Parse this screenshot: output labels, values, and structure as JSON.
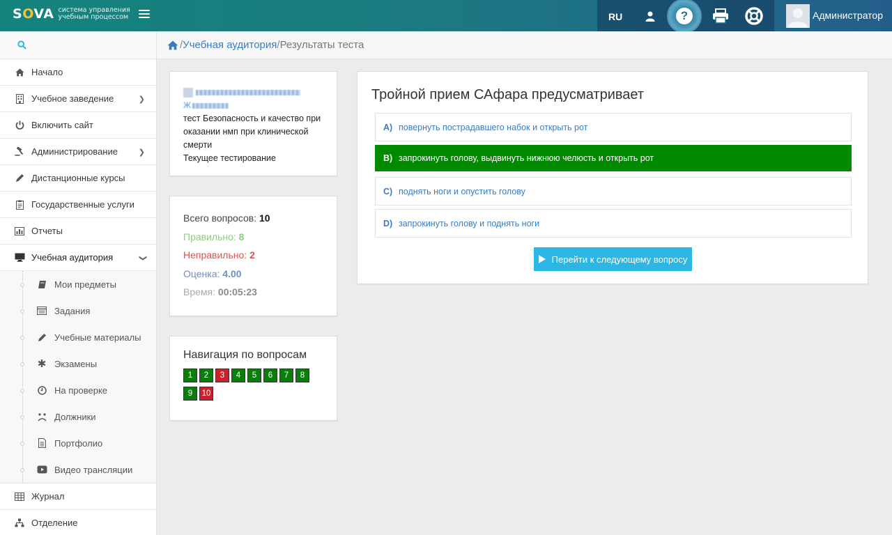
{
  "header": {
    "logo_text": "SOVA",
    "logo_sub_line1": "система управления",
    "logo_sub_line2": "учебным процессом",
    "lang": "RU",
    "user_name": "Администратор",
    "icons": [
      "user-icon",
      "help-icon",
      "print-icon",
      "lifebuoy-icon"
    ]
  },
  "sidebar": {
    "items": [
      {
        "label": "Начало",
        "icon": "home-icon"
      },
      {
        "label": "Учебное заведение",
        "icon": "building-icon",
        "has_children": true
      },
      {
        "label": "Включить сайт",
        "icon": "power-icon"
      },
      {
        "label": "Администрирование",
        "icon": "gavel-icon",
        "has_children": true
      },
      {
        "label": "Дистанционные курсы",
        "icon": "pencil-icon"
      },
      {
        "label": "Государственные услуги",
        "icon": "clipboard-icon"
      },
      {
        "label": "Отчеты",
        "icon": "bar-chart-icon"
      },
      {
        "label": "Учебная аудитория",
        "icon": "desktop-icon",
        "expanded": true
      }
    ],
    "subitems": [
      {
        "label": "Мои предметы",
        "icon": "book-icon"
      },
      {
        "label": "Задания",
        "icon": "list-icon"
      },
      {
        "label": "Учебные материалы",
        "icon": "pencil-icon"
      },
      {
        "label": "Экзамены",
        "icon": "asterisk-icon"
      },
      {
        "label": "На проверке",
        "icon": "clock-icon"
      },
      {
        "label": "Должники",
        "icon": "sad-face-icon"
      },
      {
        "label": "Портфолио",
        "icon": "document-icon"
      },
      {
        "label": "Видео трансляции",
        "icon": "video-icon"
      }
    ],
    "items_after": [
      {
        "label": "Журнал",
        "icon": "table-icon"
      },
      {
        "label": "Отделение",
        "icon": "sitemap-icon"
      }
    ]
  },
  "breadcrumb": {
    "sep": "/",
    "link": "Учебная аудитория",
    "current": "Результаты теста"
  },
  "info": {
    "test_line": "тест Безопасность и качество при оказании нмп при клинической смерти",
    "status": "Текущее тестирование"
  },
  "stats": {
    "total_label": "Всего вопросов:",
    "total_value": "10",
    "correct_label": "Правильно:",
    "correct_value": "8",
    "wrong_label": "Неправильно:",
    "wrong_value": "2",
    "score_label": "Оценка:",
    "score_value": "4.00",
    "time_label": "Время:",
    "time_value": "00:05:23"
  },
  "navigation": {
    "title": "Навигация по вопросам",
    "questions": [
      {
        "n": "1",
        "status": "correct"
      },
      {
        "n": "2",
        "status": "correct"
      },
      {
        "n": "3",
        "status": "wrong"
      },
      {
        "n": "4",
        "status": "correct"
      },
      {
        "n": "5",
        "status": "correct"
      },
      {
        "n": "6",
        "status": "correct"
      },
      {
        "n": "7",
        "status": "correct"
      },
      {
        "n": "8",
        "status": "correct"
      },
      {
        "n": "9",
        "status": "correct"
      },
      {
        "n": "10",
        "status": "wrong"
      }
    ],
    "colors": {
      "correct": "#0a7d0a",
      "wrong": "#c8232c"
    }
  },
  "question": {
    "title": "Тройной прием САфара предусматривает",
    "answers": [
      {
        "label": "A)",
        "text": "повернуть пострадавшего набок и открыть рот",
        "selected": false
      },
      {
        "label": "B)",
        "text": "запрокинуть голову, выдвинуть нижнюю челюсть и открыть рот",
        "selected": true
      },
      {
        "label": "C)",
        "text": "поднять ноги и опустить голову",
        "selected": false
      },
      {
        "label": "D)",
        "text": "запрокинуть голову и поднять ноги",
        "selected": false
      }
    ],
    "next_button": "Перейти к следующему вопросу",
    "selected_color": "#008a00"
  }
}
